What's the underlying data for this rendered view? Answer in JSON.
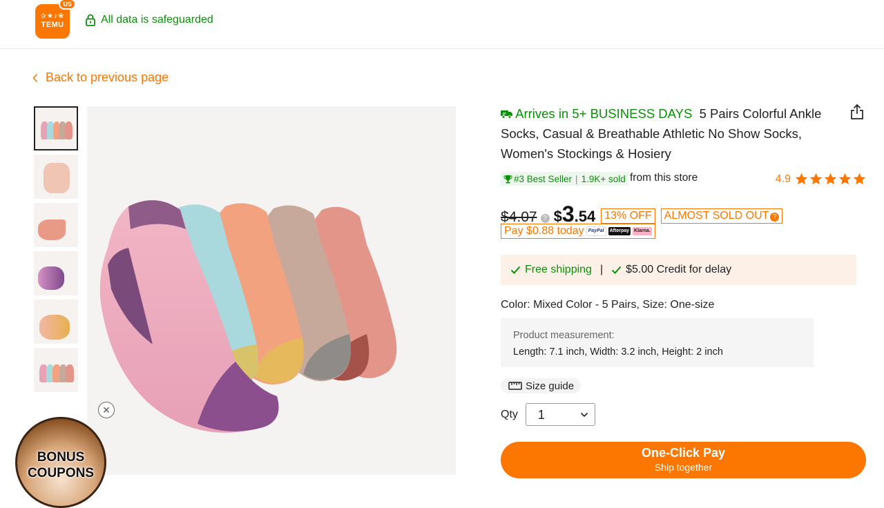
{
  "header": {
    "logo_region": "US",
    "logo_glyphs": "✰★♪❀",
    "logo_text": "TEMU",
    "safeguard_text": "All data is safeguarded"
  },
  "nav": {
    "back_label": "Back to previous page"
  },
  "product": {
    "arrival": "Arrives in 5+ BUSINESS DAYS",
    "title": "5 Pairs Colorful Ankle Socks, Casual & Breathable Athletic No Show Socks, Women's Stockings & Hosiery",
    "best_seller": "#3 Best Seller",
    "sold": "1.9K+ sold",
    "from_store": "from this store",
    "rating": "4.9",
    "rating_stars": 5,
    "old_price": "$4.07",
    "price_symbol": "$",
    "price_whole": "3",
    "price_cents": ".54",
    "discount": "13% OFF",
    "almost_sold_out": "ALMOST SOLD OUT",
    "pay_today": "Pay $0.88 today",
    "pay_methods": [
      "PayPal",
      "Afterpay",
      "Klarna."
    ],
    "free_shipping": "Free shipping",
    "separator": "|",
    "credit_delay": "$5.00 Credit for delay",
    "color_size": "Color: Mixed Color - 5 Pairs, Size: One-size",
    "measurement_label": "Product measurement:",
    "measurement_value": "Length: 7.1 inch, Width: 3.2 inch, Height: 2 inch",
    "size_guide": "Size guide",
    "qty_label": "Qty",
    "qty_value": "1",
    "buy_label": "One-Click Pay",
    "buy_sub": "Ship together"
  },
  "promo": {
    "bonus_line1": "BONUS",
    "bonus_line2": "COUPONS"
  },
  "colors": {
    "accent": "#fb7701",
    "green": "#0a8f08",
    "sock_colors": [
      "#e8a2b6",
      "#a9d9dc",
      "#f2a27e",
      "#c7a99c",
      "#e3958a"
    ]
  }
}
